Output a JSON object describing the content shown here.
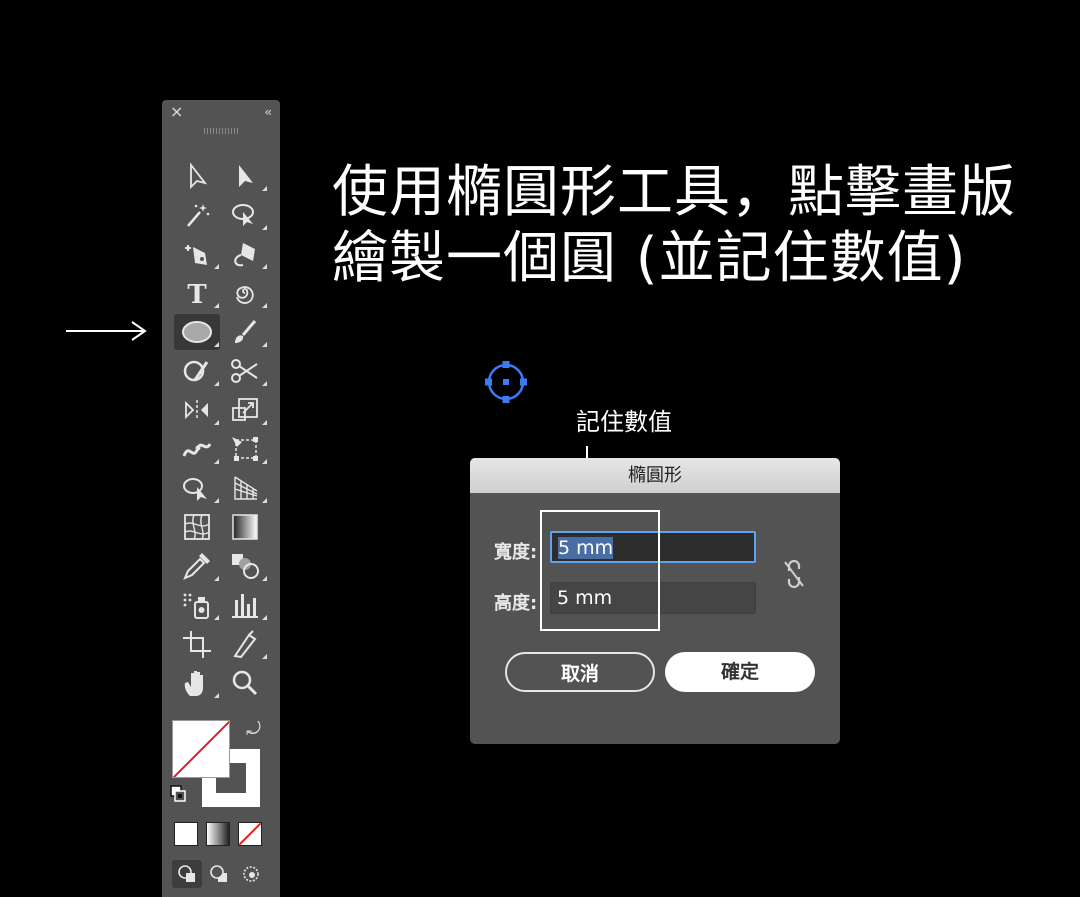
{
  "toolbar": {
    "close_glyph": "×",
    "collapse_glyph": "‹‹",
    "tools": [
      [
        "selection-tool",
        "direct-selection-tool"
      ],
      [
        "magic-wand-tool",
        "lasso-tool"
      ],
      [
        "pen-tool",
        "curvature-tool"
      ],
      [
        "type-tool",
        "spiral-tool"
      ],
      [
        "ellipse-tool",
        "paintbrush-tool"
      ],
      [
        "shaper-tool",
        "scissors-tool"
      ],
      [
        "reflect-tool",
        "scale-tool"
      ],
      [
        "width-tool",
        "free-transform-tool"
      ],
      [
        "shape-builder-tool",
        "perspective-grid-tool"
      ],
      [
        "mesh-tool",
        "gradient-tool"
      ],
      [
        "eyedropper-tool",
        "blend-tool"
      ],
      [
        "symbol-sprayer-tool",
        "column-graph-tool"
      ],
      [
        "artboard-tool",
        "slice-tool"
      ],
      [
        "hand-tool",
        "zoom-tool"
      ]
    ],
    "selected_tool": "ellipse-tool",
    "type_glyph": "T",
    "swap_glyph": "⤾",
    "colors": {
      "panel": "#535353",
      "none_red": "#e0201b"
    }
  },
  "headline": {
    "line1": "使用橢圓形工具，點擊畫版",
    "line2": "繪製一個圓 (並記住數值)"
  },
  "annotation": {
    "label": "記住數值"
  },
  "dialog": {
    "title": "橢圓形",
    "width_label": "寬度:",
    "width_value": "5 mm",
    "height_label": "高度:",
    "height_value": "5 mm",
    "cancel_label": "取消",
    "ok_label": "確定",
    "colors": {
      "focus_ring": "#5fa3ef",
      "selection": "#4a6ea3"
    }
  },
  "canvas": {
    "anchor_color": "#3d7bf5"
  }
}
